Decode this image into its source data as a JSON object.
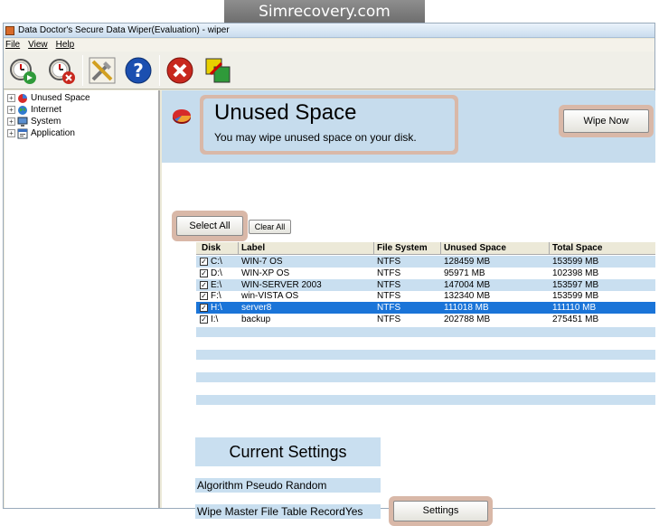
{
  "banner": "Simrecovery.com",
  "window": {
    "title": "Data Doctor's Secure Data Wiper(Evaluation) - wiper"
  },
  "menu": [
    "File",
    "View",
    "Help"
  ],
  "toolbar": {
    "icons": [
      "clock-go-icon",
      "clock-stop-icon",
      "tools-icon",
      "help-icon",
      "exit-icon",
      "window-switch-icon"
    ]
  },
  "tree": [
    {
      "label": "Unused Space",
      "icon": "pie-chart-icon"
    },
    {
      "label": "Internet",
      "icon": "globe-icon"
    },
    {
      "label": "System",
      "icon": "computer-icon"
    },
    {
      "label": "Application",
      "icon": "application-icon"
    }
  ],
  "header": {
    "title": "Unused Space",
    "subtitle": "You may wipe unused space on your disk.",
    "wipe_now": "Wipe Now"
  },
  "buttons": {
    "select_all": "Select All",
    "clear_all": "Clear All",
    "settings": "Settings"
  },
  "grid": {
    "columns": [
      "Disk",
      "Label",
      "File System",
      "Unused Space",
      "Total Space"
    ],
    "rows": [
      {
        "checked": true,
        "disk": "C:\\",
        "label": "WIN-7 OS",
        "fs": "NTFS",
        "unused": "128459 MB",
        "total": "153599 MB",
        "selected": false
      },
      {
        "checked": true,
        "disk": "D:\\",
        "label": "WIN-XP OS",
        "fs": "NTFS",
        "unused": "95971 MB",
        "total": "102398 MB",
        "selected": false
      },
      {
        "checked": true,
        "disk": "E:\\",
        "label": "WIN-SERVER 2003",
        "fs": "NTFS",
        "unused": "147004 MB",
        "total": "153597 MB",
        "selected": false
      },
      {
        "checked": true,
        "disk": "F:\\",
        "label": "win-VISTA OS",
        "fs": "NTFS",
        "unused": "132340 MB",
        "total": "153599 MB",
        "selected": false
      },
      {
        "checked": true,
        "disk": "H:\\",
        "label": "server8",
        "fs": "NTFS",
        "unused": "111018 MB",
        "total": "111110 MB",
        "selected": true
      },
      {
        "checked": true,
        "disk": "I:\\",
        "label": "backup",
        "fs": "NTFS",
        "unused": "202788 MB",
        "total": "275451 MB",
        "selected": false
      }
    ]
  },
  "settings": {
    "title": "Current Settings",
    "algorithm": "Algorithm Pseudo Random",
    "mft": "Wipe Master File Table RecordYes"
  },
  "colors": {
    "selected_row": "#1a74d8",
    "stripe": "#c9dff0",
    "header_band": "#c6dced",
    "highlight": "#d9b8a8"
  }
}
